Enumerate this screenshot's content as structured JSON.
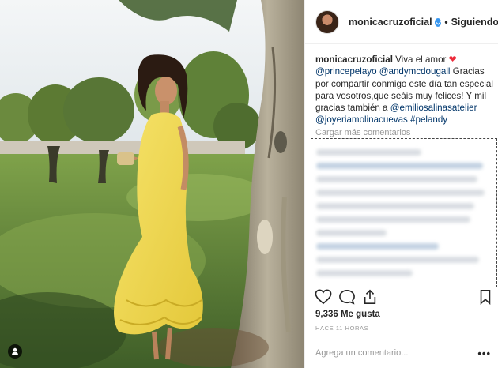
{
  "post": {
    "username": "monicacruzoficial",
    "follow_status": "Siguiendo",
    "separator": "•",
    "caption": {
      "username": "monicacruzoficial",
      "text1": " Viva el amor ",
      "mention1": "@princepelayo",
      "text2": " ",
      "mention2": "@andymcdougall",
      "text3": " Gracias por compartir conmigo este día tan especial para vosotros,que seáis muy felices! Y mil gracias también a ",
      "mention3": "@emiliosalinasatelier",
      "text4": " ",
      "mention4": "@joyeriamolinacuevas",
      "text5": " ",
      "hashtag": "#pelandy"
    },
    "load_more": "Cargar más comentarios",
    "likes": "9,336 Me gusta",
    "time_ago": "HACE 11 HORAS",
    "comment_placeholder": "Agrega un comentario...",
    "more_options": "•••"
  },
  "icons": {
    "verified": "verified-badge-icon",
    "heart": "heart-icon",
    "like": "like-heart-icon",
    "comment": "comment-bubble-icon",
    "share": "share-icon",
    "save": "bookmark-icon",
    "user_tag": "user-tag-icon"
  },
  "colors": {
    "link": "#003569",
    "verified": "#3897f0",
    "heart": "#ed2b3a",
    "muted": "#999999"
  }
}
